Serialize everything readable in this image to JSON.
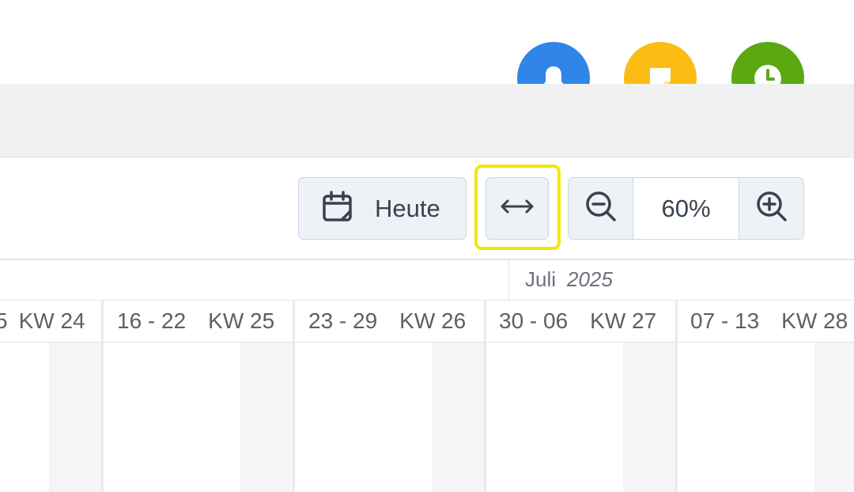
{
  "header": {
    "actions": [
      {
        "name": "notifications",
        "icon": "bell-icon",
        "color": "#2f85e8"
      },
      {
        "name": "notes",
        "icon": "sticky-note-icon",
        "color": "#fbbd14"
      },
      {
        "name": "time-tracking",
        "icon": "clock-icon",
        "color": "#5aa812"
      }
    ]
  },
  "toolbar": {
    "today_label": "Heute",
    "today_icon": "calendar-icon",
    "fit_icon": "arrows-horizontal-icon",
    "zoom_out_icon": "zoom-out-icon",
    "zoom_in_icon": "zoom-in-icon",
    "zoom_value": "60%",
    "highlight_color": "#f5e60c"
  },
  "timeline": {
    "month": "Juli",
    "year": "2025",
    "weeks": [
      {
        "range": "5",
        "kw": "KW 24"
      },
      {
        "range": "16 - 22",
        "kw": "KW 25"
      },
      {
        "range": "23 - 29",
        "kw": "KW 26"
      },
      {
        "range": "30 - 06",
        "kw": "KW 27"
      },
      {
        "range": "07 - 13",
        "kw": "KW 28"
      }
    ]
  }
}
